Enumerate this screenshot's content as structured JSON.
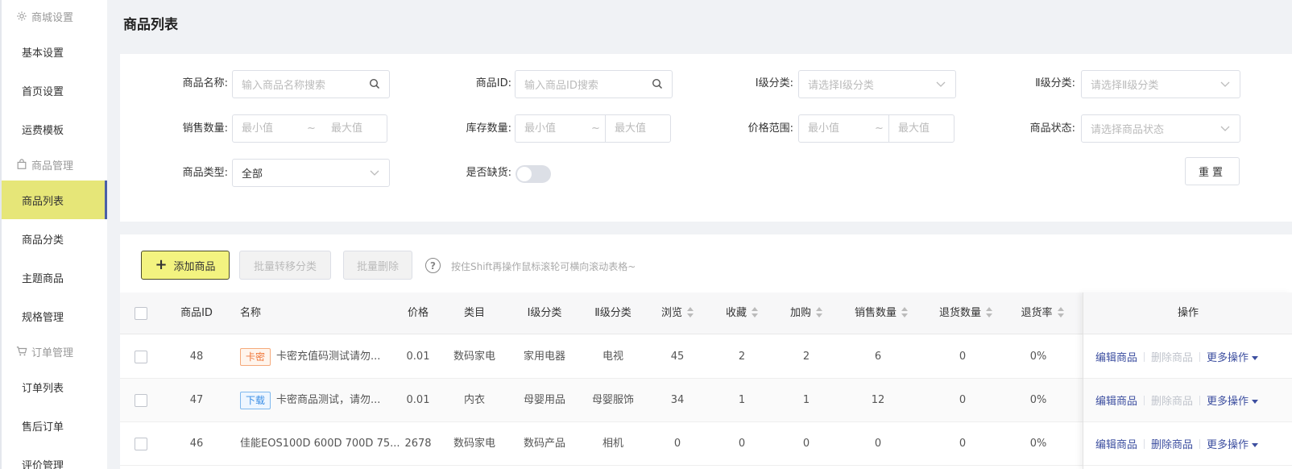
{
  "sidebar": {
    "groups": [
      {
        "label": "商城设置",
        "icon": "gear-icon",
        "items": [
          "基本设置",
          "首页设置",
          "运费模板"
        ]
      },
      {
        "label": "商品管理",
        "icon": "bag-icon",
        "items": [
          "商品列表",
          "商品分类",
          "主题商品",
          "规格管理"
        ]
      },
      {
        "label": "订单管理",
        "icon": "cart-icon",
        "items": [
          "订单列表",
          "售后订单",
          "评价管理"
        ]
      }
    ],
    "active": "商品列表"
  },
  "page_title": "商品列表",
  "filters": {
    "name_label": "商品名称:",
    "name_placeholder": "输入商品名称搜索",
    "id_label": "商品ID:",
    "id_placeholder": "输入商品ID搜索",
    "cat1_label": "Ⅰ级分类:",
    "cat1_placeholder": "请选择Ⅰ级分类",
    "cat2_label": "Ⅱ级分类:",
    "cat2_placeholder": "请选择Ⅱ级分类",
    "sales_label": "销售数量:",
    "stock_label": "库存数量:",
    "price_label": "价格范围:",
    "status_label": "商品状态:",
    "status_placeholder": "请选择商品状态",
    "min": "最小值",
    "max": "最大值",
    "tilde": "~",
    "type_label": "商品类型:",
    "type_value": "全部",
    "outofstock_label": "是否缺货:",
    "reset_label": "重置"
  },
  "toolbar": {
    "add_label": "添加商品",
    "move_label": "批量转移分类",
    "delete_label": "批量删除",
    "hint": "按住Shift再操作鼠标滚轮可横向滚动表格~"
  },
  "table": {
    "headers": {
      "id": "商品ID",
      "name": "名称",
      "price": "价格",
      "category": "类目",
      "cat1": "Ⅰ级分类",
      "cat2": "Ⅱ级分类",
      "views": "浏览",
      "favs": "收藏",
      "cart": "加购",
      "sales": "销售数量",
      "returns": "退货数量",
      "return_rate": "退货率",
      "ops": "操作"
    },
    "rows": [
      {
        "id": "48",
        "tag": "卡密",
        "name": "卡密充值码测试请勿...",
        "price": "0.01",
        "category": "数码家电",
        "cat1": "家用电器",
        "cat2": "电视",
        "views": "45",
        "favs": "2",
        "cart": "2",
        "sales": "6",
        "returns": "0",
        "return_rate": "0%"
      },
      {
        "id": "47",
        "tag": "下载",
        "name": "卡密商品测试，请勿...",
        "price": "0.01",
        "category": "内衣",
        "cat1": "母婴用品",
        "cat2": "母婴服饰",
        "views": "34",
        "favs": "1",
        "cart": "1",
        "sales": "12",
        "returns": "0",
        "return_rate": "0%"
      },
      {
        "id": "46",
        "tag": "",
        "name": "佳能EOS100D 600D 700D 75...",
        "price": "2678",
        "category": "数码家电",
        "cat1": "数码产品",
        "cat2": "相机",
        "views": "0",
        "favs": "0",
        "cart": "0",
        "sales": "0",
        "returns": "0",
        "return_rate": "0%"
      }
    ],
    "ops": {
      "edit": "编辑商品",
      "delete": "删除商品",
      "more": "更多操作"
    }
  },
  "colors": {
    "accent": "#f3f380",
    "active_bg": "#e6e678",
    "link": "#3d4fa0"
  }
}
